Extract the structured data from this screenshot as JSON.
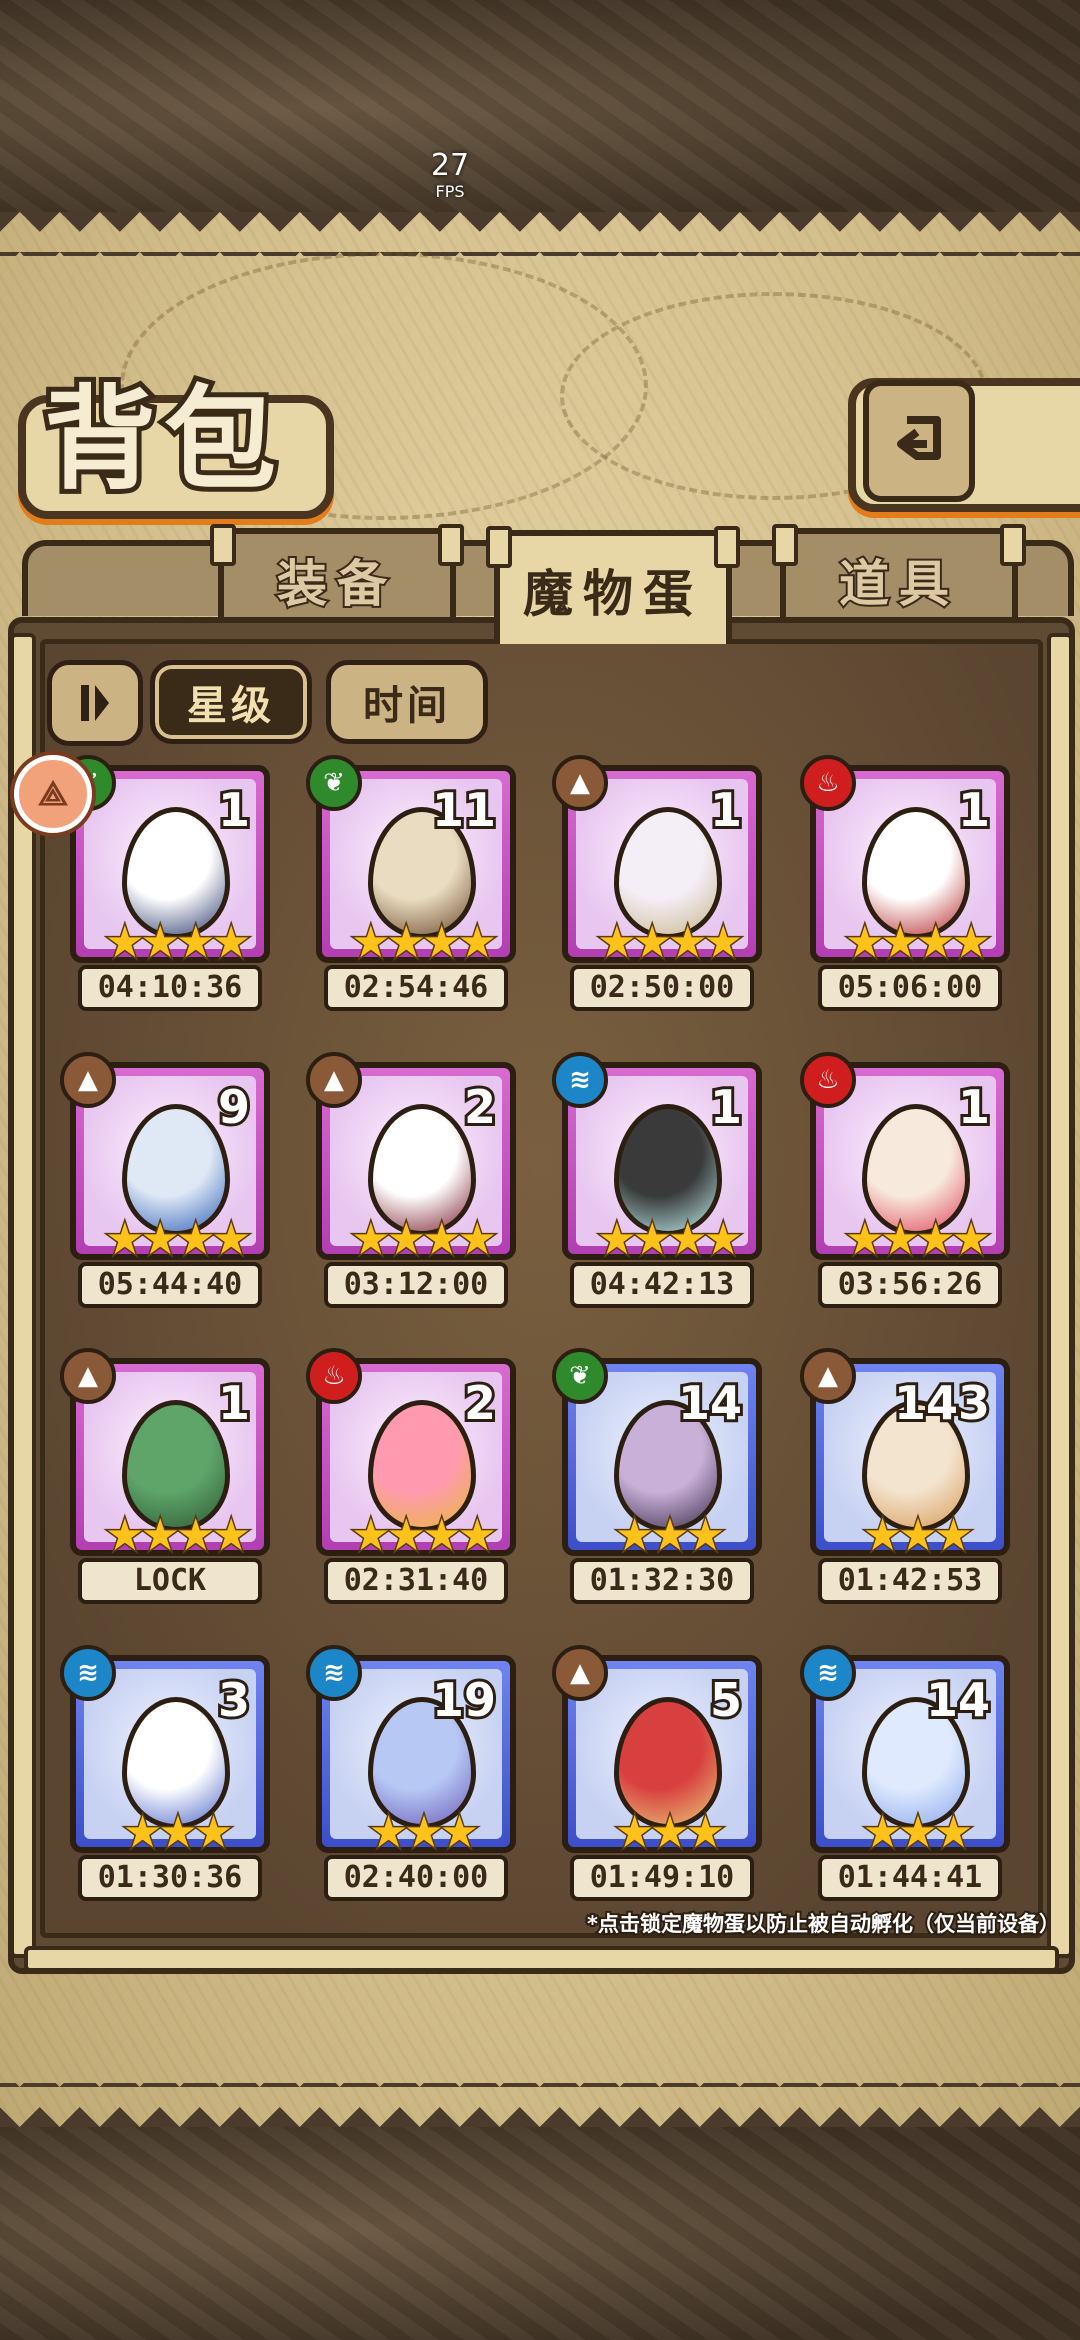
{
  "overlay": {
    "fps_value": "27",
    "fps_label": "FPS"
  },
  "header": {
    "title": "背包",
    "back_icon": "back-arrow-icon"
  },
  "tabs": [
    {
      "label": "装备",
      "active": false
    },
    {
      "label": "魔物蛋",
      "active": true
    },
    {
      "label": "道具",
      "active": false
    }
  ],
  "sort": {
    "toggle_icon": "sort-order-icon",
    "options": [
      {
        "label": "星级",
        "active": true
      },
      {
        "label": "时间",
        "active": false
      }
    ]
  },
  "eggs": [
    {
      "element": "grass",
      "count": "1",
      "stars": 4,
      "timer": "04:10:36",
      "colors": [
        "#ffffff",
        "#2b3a6b"
      ]
    },
    {
      "element": "grass",
      "count": "11",
      "stars": 4,
      "timer": "02:54:46",
      "colors": [
        "#e9dcc0",
        "#6b4a2e"
      ]
    },
    {
      "element": "rock",
      "count": "1",
      "stars": 4,
      "timer": "02:50:00",
      "colors": [
        "#f4eef7",
        "#c9b68a"
      ]
    },
    {
      "element": "fire",
      "count": "1",
      "stars": 4,
      "timer": "05:06:00",
      "colors": [
        "#ffffff",
        "#b52a2a"
      ]
    },
    {
      "element": "rock",
      "count": "9",
      "stars": 4,
      "timer": "05:44:40",
      "colors": [
        "#dfe8f5",
        "#2f5fb8"
      ]
    },
    {
      "element": "rock",
      "count": "2",
      "stars": 4,
      "timer": "03:12:00",
      "colors": [
        "#ffffff",
        "#7a2030"
      ]
    },
    {
      "element": "water",
      "count": "1",
      "stars": 4,
      "timer": "04:42:13",
      "colors": [
        "#3a3a3a",
        "#bfeeee"
      ]
    },
    {
      "element": "fire",
      "count": "1",
      "stars": 4,
      "timer": "03:56:26",
      "colors": [
        "#f7eadd",
        "#e0455a"
      ]
    },
    {
      "element": "rock",
      "count": "1",
      "stars": 4,
      "timer": "LOCK",
      "colors": [
        "#5fa56a",
        "#2d5a34"
      ]
    },
    {
      "element": "fire",
      "count": "2",
      "stars": 4,
      "timer": "02:31:40",
      "colors": [
        "#ff9ab0",
        "#e8b83a"
      ]
    },
    {
      "element": "grass",
      "count": "14",
      "stars": 3,
      "timer": "01:32:30",
      "colors": [
        "#c9b0d8",
        "#3a2f4a"
      ]
    },
    {
      "element": "rock",
      "count": "143",
      "stars": 3,
      "timer": "01:42:53",
      "colors": [
        "#f3e4cf",
        "#d89a55"
      ]
    },
    {
      "element": "water",
      "count": "3",
      "stars": 3,
      "timer": "01:30:36",
      "colors": [
        "#ffffff",
        "#5068c8"
      ]
    },
    {
      "element": "water",
      "count": "19",
      "stars": 3,
      "timer": "02:40:00",
      "colors": [
        "#b8c8f5",
        "#6b5fb8"
      ]
    },
    {
      "element": "rock",
      "count": "5",
      "stars": 3,
      "timer": "01:49:10",
      "colors": [
        "#d84040",
        "#e8c878"
      ]
    },
    {
      "element": "water",
      "count": "14",
      "stars": 3,
      "timer": "01:44:41",
      "colors": [
        "#dfeaff",
        "#8aa8e8"
      ]
    }
  ],
  "footer_hint": "*点击锁定魔物蛋以防止被自动孵化（仅当前设备）"
}
